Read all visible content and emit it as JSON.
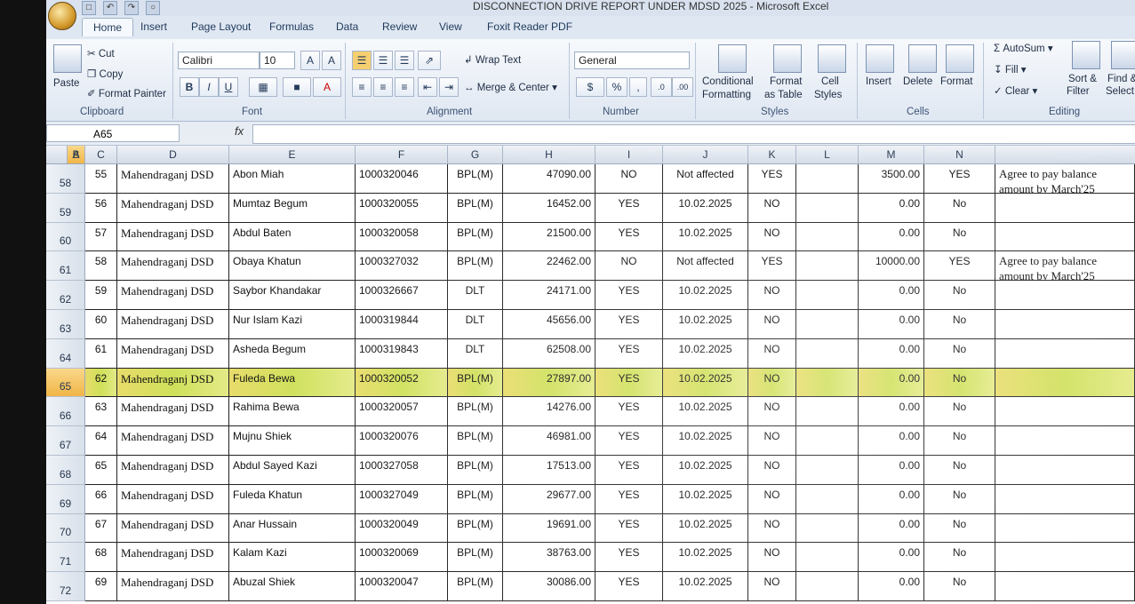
{
  "window": {
    "title": "DISCONNECTION DRIVE REPORT UNDER MDSD 2025 - Microsoft Excel"
  },
  "tabs": [
    "Home",
    "Insert",
    "Page Layout",
    "Formulas",
    "Data",
    "Review",
    "View",
    "Foxit Reader PDF"
  ],
  "ribbon": {
    "clipboard": {
      "paste": "Paste",
      "cut": "Cut",
      "copy": "Copy",
      "format_painter": "Format Painter",
      "label": "Clipboard"
    },
    "font": {
      "name": "Calibri",
      "size": "10",
      "bold": "B",
      "italic": "I",
      "underline": "U",
      "label": "Font"
    },
    "alignment": {
      "wrap_text": "Wrap Text",
      "merge_center": "Merge & Center",
      "label": "Alignment"
    },
    "number": {
      "format": "General",
      "percent": "%",
      "label": "Number"
    },
    "styles": {
      "conditional": "Conditional",
      "formatting": "Formatting",
      "format": "Format",
      "as_table": "as Table",
      "cell": "Cell",
      "cell_styles": "Styles",
      "label": "Styles"
    },
    "cells": {
      "insert": "Insert",
      "delete": "Delete",
      "format": "Format",
      "label": "Cells"
    },
    "editing": {
      "autosum": "AutoSum",
      "fill": "Fill",
      "clear": "Clear",
      "sort": "Sort &",
      "filter": "Filter",
      "find": "Find &",
      "select": "Select",
      "label": "Editing"
    }
  },
  "formula_bar": {
    "name_box": "A65",
    "fx": "fx",
    "content": ""
  },
  "columns": [
    "A",
    "B",
    "C",
    "D",
    "E",
    "F",
    "G",
    "H",
    "I",
    "J",
    "K",
    "L",
    "M",
    "N"
  ],
  "selected_column": "A",
  "selected_row": "65",
  "rows": [
    {
      "r": "58",
      "b": "55",
      "c": "Mahendraganj DSD",
      "d": "Abon Miah",
      "e": "1000320046",
      "f": "BPL(M)",
      "g": "47090.00",
      "h": "NO",
      "i": "Not affected",
      "j": "YES",
      "l": "3500.00",
      "m": "YES",
      "n": "Agree to pay balance amount by March'25"
    },
    {
      "r": "59",
      "b": "56",
      "c": "Mahendraganj DSD",
      "d": "Mumtaz Begum",
      "e": "1000320055",
      "f": "BPL(M)",
      "g": "16452.00",
      "h": "YES",
      "i": "10.02.2025",
      "j": "NO",
      "l": "0.00",
      "m": "No",
      "n": ""
    },
    {
      "r": "60",
      "b": "57",
      "c": "Mahendraganj DSD",
      "d": "Abdul Baten",
      "e": "1000320058",
      "f": "BPL(M)",
      "g": "21500.00",
      "h": "YES",
      "i": "10.02.2025",
      "j": "NO",
      "l": "0.00",
      "m": "No",
      "n": ""
    },
    {
      "r": "61",
      "b": "58",
      "c": "Mahendraganj DSD",
      "d": "Obaya Khatun",
      "e": "1000327032",
      "f": "BPL(M)",
      "g": "22462.00",
      "h": "NO",
      "i": "Not affected",
      "j": "YES",
      "l": "10000.00",
      "m": "YES",
      "n": "Agree to pay balance amount by March'25"
    },
    {
      "r": "62",
      "b": "59",
      "c": "Mahendraganj DSD",
      "d": "Saybor Khandakar",
      "e": "1000326667",
      "f": "DLT",
      "g": "24171.00",
      "h": "YES",
      "i": "10.02.2025",
      "j": "NO",
      "l": "0.00",
      "m": "No",
      "n": ""
    },
    {
      "r": "63",
      "b": "60",
      "c": "Mahendraganj DSD",
      "d": "Nur Islam Kazi",
      "e": "1000319844",
      "f": "DLT",
      "g": "45656.00",
      "h": "YES",
      "i": "10.02.2025",
      "j": "NO",
      "l": "0.00",
      "m": "No",
      "n": ""
    },
    {
      "r": "64",
      "b": "61",
      "c": "Mahendraganj DSD",
      "d": "Asheda Begum",
      "e": "1000319843",
      "f": "DLT",
      "g": "62508.00",
      "h": "YES",
      "i": "10.02.2025",
      "j": "NO",
      "l": "0.00",
      "m": "No",
      "n": ""
    },
    {
      "r": "65",
      "b": "62",
      "c": "Mahendraganj DSD",
      "d": "Fuleda Bewa",
      "e": "1000320052",
      "f": "BPL(M)",
      "g": "27897.00",
      "h": "YES",
      "i": "10.02.2025",
      "j": "NO",
      "l": "0.00",
      "m": "No",
      "n": ""
    },
    {
      "r": "66",
      "b": "63",
      "c": "Mahendraganj DSD",
      "d": "Rahima Bewa",
      "e": "1000320057",
      "f": "BPL(M)",
      "g": "14276.00",
      "h": "YES",
      "i": "10.02.2025",
      "j": "NO",
      "l": "0.00",
      "m": "No",
      "n": ""
    },
    {
      "r": "67",
      "b": "64",
      "c": "Mahendraganj DSD",
      "d": "Mujnu Shiek",
      "e": "1000320076",
      "f": "BPL(M)",
      "g": "46981.00",
      "h": "YES",
      "i": "10.02.2025",
      "j": "NO",
      "l": "0.00",
      "m": "No",
      "n": ""
    },
    {
      "r": "68",
      "b": "65",
      "c": "Mahendraganj DSD",
      "d": "Abdul Sayed Kazi",
      "e": "1000327058",
      "f": "BPL(M)",
      "g": "17513.00",
      "h": "YES",
      "i": "10.02.2025",
      "j": "NO",
      "l": "0.00",
      "m": "No",
      "n": ""
    },
    {
      "r": "69",
      "b": "66",
      "c": "Mahendraganj DSD",
      "d": "Fuleda Khatun",
      "e": "1000327049",
      "f": "BPL(M)",
      "g": "29677.00",
      "h": "YES",
      "i": "10.02.2025",
      "j": "NO",
      "l": "0.00",
      "m": "No",
      "n": ""
    },
    {
      "r": "70",
      "b": "67",
      "c": "Mahendraganj DSD",
      "d": "Anar Hussain",
      "e": "1000320049",
      "f": "BPL(M)",
      "g": "19691.00",
      "h": "YES",
      "i": "10.02.2025",
      "j": "NO",
      "l": "0.00",
      "m": "No",
      "n": ""
    },
    {
      "r": "71",
      "b": "68",
      "c": "Mahendraganj DSD",
      "d": "Kalam Kazi",
      "e": "1000320069",
      "f": "BPL(M)",
      "g": "38763.00",
      "h": "YES",
      "i": "10.02.2025",
      "j": "NO",
      "l": "0.00",
      "m": "No",
      "n": ""
    },
    {
      "r": "72",
      "b": "69",
      "c": "Mahendraganj DSD",
      "d": "Abuzal Shiek",
      "e": "1000320047",
      "f": "BPL(M)",
      "g": "30086.00",
      "h": "YES",
      "i": "10.02.2025",
      "j": "NO",
      "l": "0.00",
      "m": "No",
      "n": ""
    }
  ]
}
